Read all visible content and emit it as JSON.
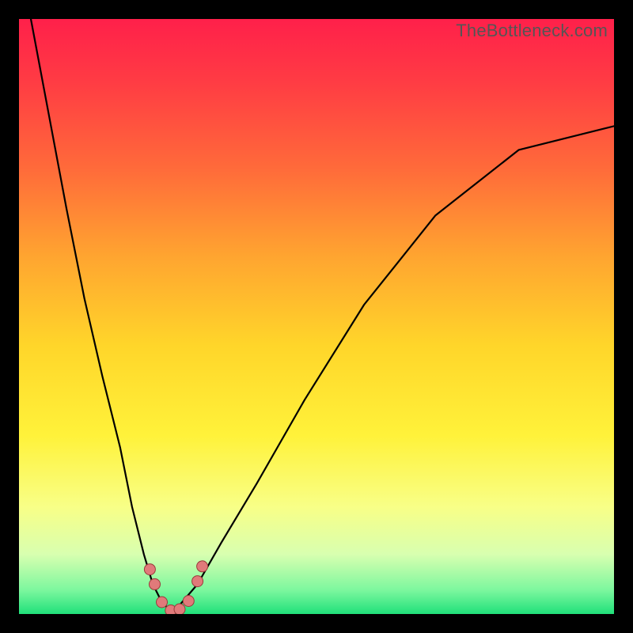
{
  "watermark": "TheBottleneck.com",
  "colors": {
    "frame_bg": "#ffffff",
    "page_bg": "#000000",
    "gradient_stops": [
      {
        "offset": 0.0,
        "color": "#ff204a"
      },
      {
        "offset": 0.1,
        "color": "#ff3a44"
      },
      {
        "offset": 0.25,
        "color": "#ff6a3a"
      },
      {
        "offset": 0.4,
        "color": "#ffa530"
      },
      {
        "offset": 0.55,
        "color": "#ffd62a"
      },
      {
        "offset": 0.7,
        "color": "#fff23a"
      },
      {
        "offset": 0.82,
        "color": "#f8ff87"
      },
      {
        "offset": 0.9,
        "color": "#d8ffb0"
      },
      {
        "offset": 0.96,
        "color": "#7cf79e"
      },
      {
        "offset": 1.0,
        "color": "#20e07a"
      }
    ],
    "curve": "#000000",
    "marker_fill": "#e07a7a",
    "marker_stroke": "#9a3a3a"
  },
  "chart_data": {
    "type": "line",
    "title": "",
    "xlabel": "",
    "ylabel": "",
    "xlim": [
      0,
      100
    ],
    "ylim": [
      0,
      100
    ],
    "series": [
      {
        "name": "bottleneck-curve",
        "x": [
          2,
          5,
          8,
          11,
          14,
          17,
          19,
          21,
          22.5,
          24,
          25.5,
          27,
          30,
          34,
          40,
          48,
          58,
          70,
          84,
          100
        ],
        "y": [
          100,
          84,
          68,
          53,
          40,
          28,
          18,
          10,
          5,
          2,
          0.5,
          1.5,
          5,
          12,
          22,
          36,
          52,
          67,
          78,
          82
        ]
      }
    ],
    "markers": {
      "name": "highlighted-points",
      "points": [
        {
          "x": 22.0,
          "y": 7.5
        },
        {
          "x": 22.8,
          "y": 5.0
        },
        {
          "x": 24.0,
          "y": 2.0
        },
        {
          "x": 25.5,
          "y": 0.6
        },
        {
          "x": 27.0,
          "y": 0.8
        },
        {
          "x": 28.5,
          "y": 2.2
        },
        {
          "x": 30.0,
          "y": 5.5
        },
        {
          "x": 30.8,
          "y": 8.0
        }
      ]
    }
  }
}
